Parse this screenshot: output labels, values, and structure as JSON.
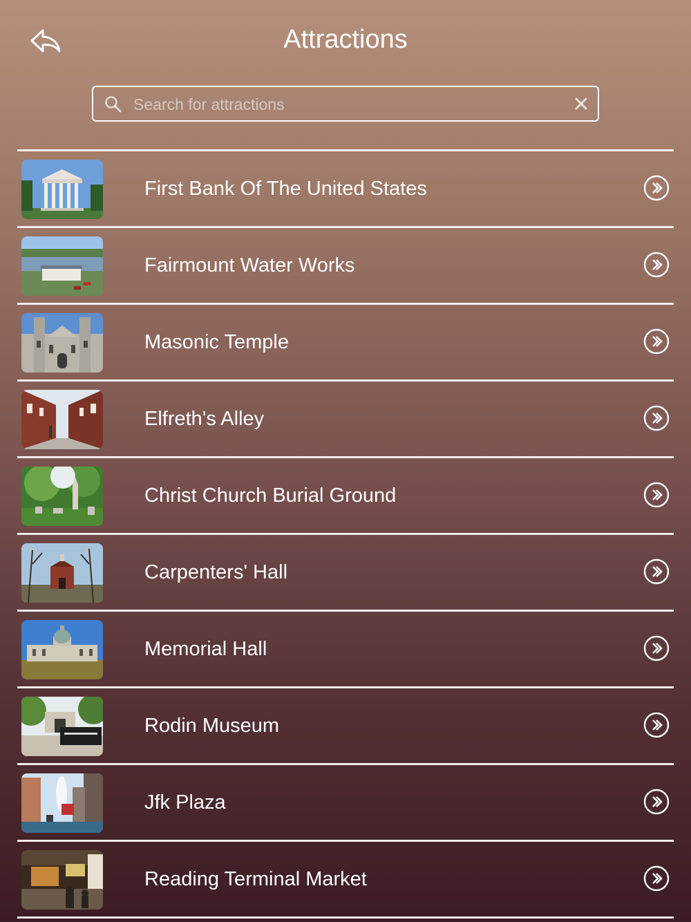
{
  "header": {
    "title": "Attractions",
    "back_icon": "reply-arrow-icon"
  },
  "search": {
    "placeholder": "Search for attractions",
    "value": "",
    "icon": "search-icon",
    "clear_icon": "close-icon"
  },
  "colors": {
    "bg_top": "#b4907c",
    "bg_bottom": "#3b1c22",
    "text": "#ffffff",
    "divider": "#f2ecea"
  },
  "attractions": [
    {
      "name": "First Bank Of The United States",
      "thumb": "neoclassical-bank-photo"
    },
    {
      "name": "Fairmount Water Works",
      "thumb": "riverside-water-works-photo"
    },
    {
      "name": "Masonic Temple",
      "thumb": "gothic-temple-photo"
    },
    {
      "name": "Elfreth's Alley",
      "thumb": "brick-alley-photo"
    },
    {
      "name": "Christ Church Burial Ground",
      "thumb": "cemetery-photo"
    },
    {
      "name": "Carpenters' Hall",
      "thumb": "brick-hall-photo"
    },
    {
      "name": "Memorial Hall",
      "thumb": "domed-hall-photo"
    },
    {
      "name": "Rodin Museum",
      "thumb": "museum-gate-photo"
    },
    {
      "name": "Jfk Plaza",
      "thumb": "love-fountain-photo"
    },
    {
      "name": "Reading Terminal Market",
      "thumb": "market-interior-photo"
    }
  ]
}
